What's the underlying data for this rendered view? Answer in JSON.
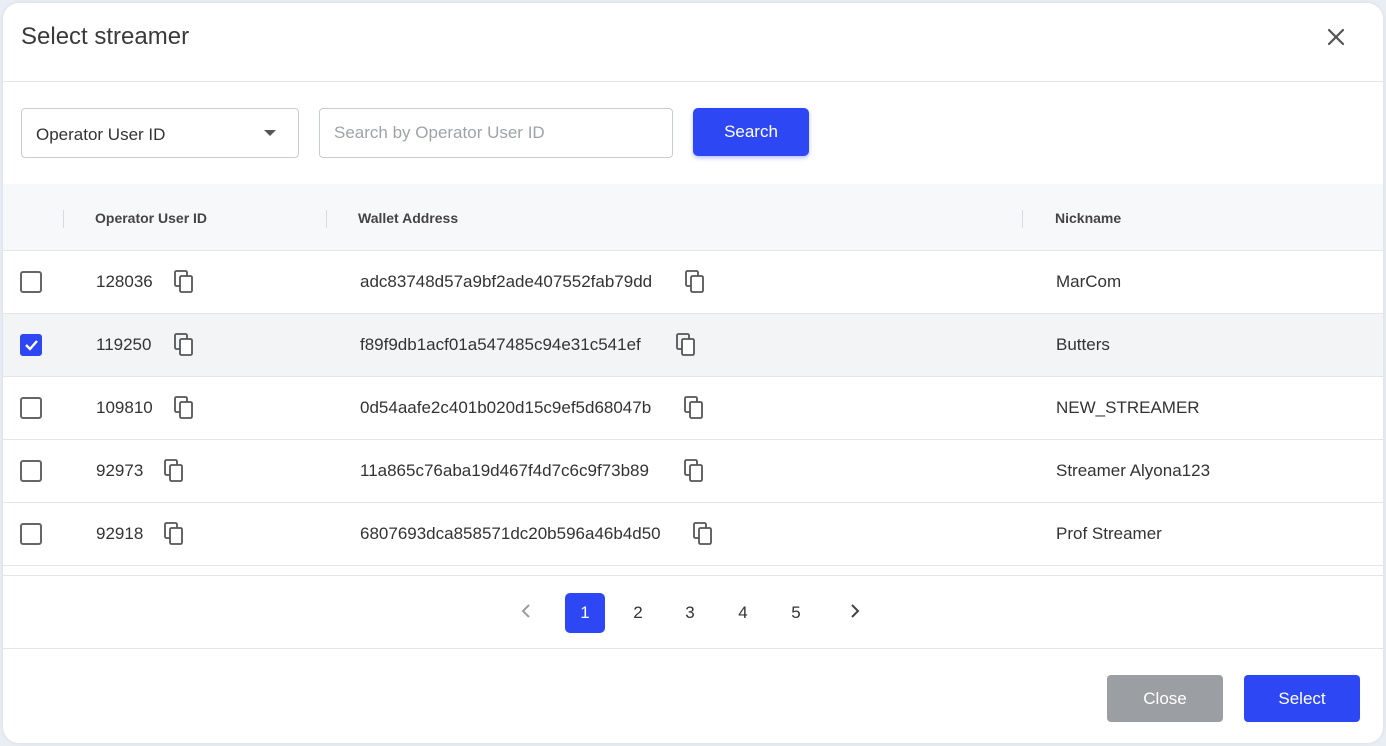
{
  "dialog": {
    "title": "Select streamer",
    "close_icon": "close-icon"
  },
  "filter": {
    "field_select_value": "Operator User ID",
    "search_placeholder": "Search by Operator User ID",
    "search_value": "",
    "search_button": "Search"
  },
  "table": {
    "columns": [
      "Operator User ID",
      "Wallet Address",
      "Nickname"
    ],
    "rows": [
      {
        "checked": false,
        "user_id": "128036",
        "wallet": "adc83748d57a9bf2ade407552fab79dd",
        "nickname": "MarCom"
      },
      {
        "checked": true,
        "user_id": "119250",
        "wallet": "f89f9db1acf01a547485c94e31c541ef",
        "nickname": "Butters"
      },
      {
        "checked": false,
        "user_id": "109810",
        "wallet": "0d54aafe2c401b020d15c9ef5d68047b",
        "nickname": "NEW_STREAMER"
      },
      {
        "checked": false,
        "user_id": "92973",
        "wallet": "11a865c76aba19d467f4d7c6c9f73b89",
        "nickname": "Streamer Alyona123"
      },
      {
        "checked": false,
        "user_id": "92918",
        "wallet": "6807693dca858571dc20b596a46b4d50",
        "nickname": "Prof Streamer"
      }
    ]
  },
  "pagination": {
    "pages": [
      "1",
      "2",
      "3",
      "4",
      "5"
    ],
    "current": "1"
  },
  "footer": {
    "close_label": "Close",
    "select_label": "Select"
  },
  "colors": {
    "accent": "#2e47f5",
    "close_button": "#9b9ea3",
    "selected_row": "#f3f4f6"
  }
}
